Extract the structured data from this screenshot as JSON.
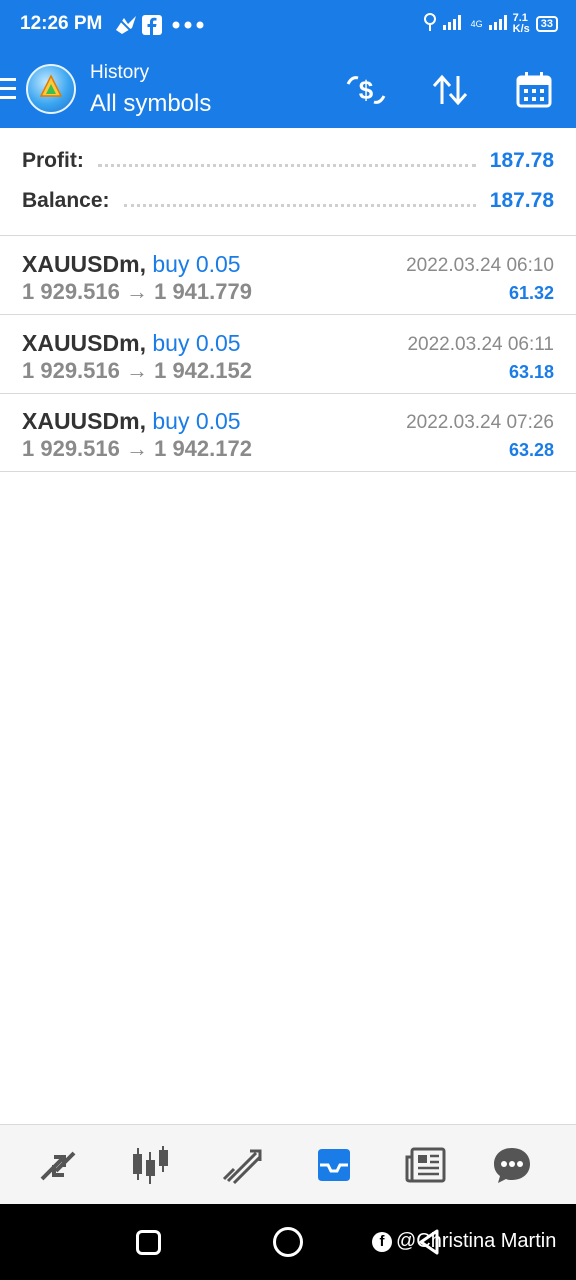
{
  "status_bar": {
    "time": "12:26 PM",
    "network_speed_value": "7.1",
    "network_speed_unit": "K/s",
    "network_type": "4G",
    "battery": "33"
  },
  "header": {
    "subtitle": "History",
    "title": "All symbols"
  },
  "summary": {
    "profit_label": "Profit:",
    "profit_value": "187.78",
    "balance_label": "Balance:",
    "balance_value": "187.78"
  },
  "deals": [
    {
      "symbol": "XAUUSDm,",
      "side": "buy 0.05",
      "prices": "1 929.516 → 1 941.779",
      "datetime": "2022.03.24 06:10",
      "profit": "61.32"
    },
    {
      "symbol": "XAUUSDm,",
      "side": "buy 0.05",
      "prices": "1 929.516 → 1 942.152",
      "datetime": "2022.03.24 06:11",
      "profit": "63.18"
    },
    {
      "symbol": "XAUUSDm,",
      "side": "buy 0.05",
      "prices": "1 929.516 → 1 942.172",
      "datetime": "2022.03.24 07:26",
      "profit": "63.28"
    }
  ],
  "watermark": "@Christina Martin",
  "colors": {
    "accent": "#1a7ce6",
    "nav_active": "#1a7ce6",
    "nav_inactive": "#555555"
  }
}
